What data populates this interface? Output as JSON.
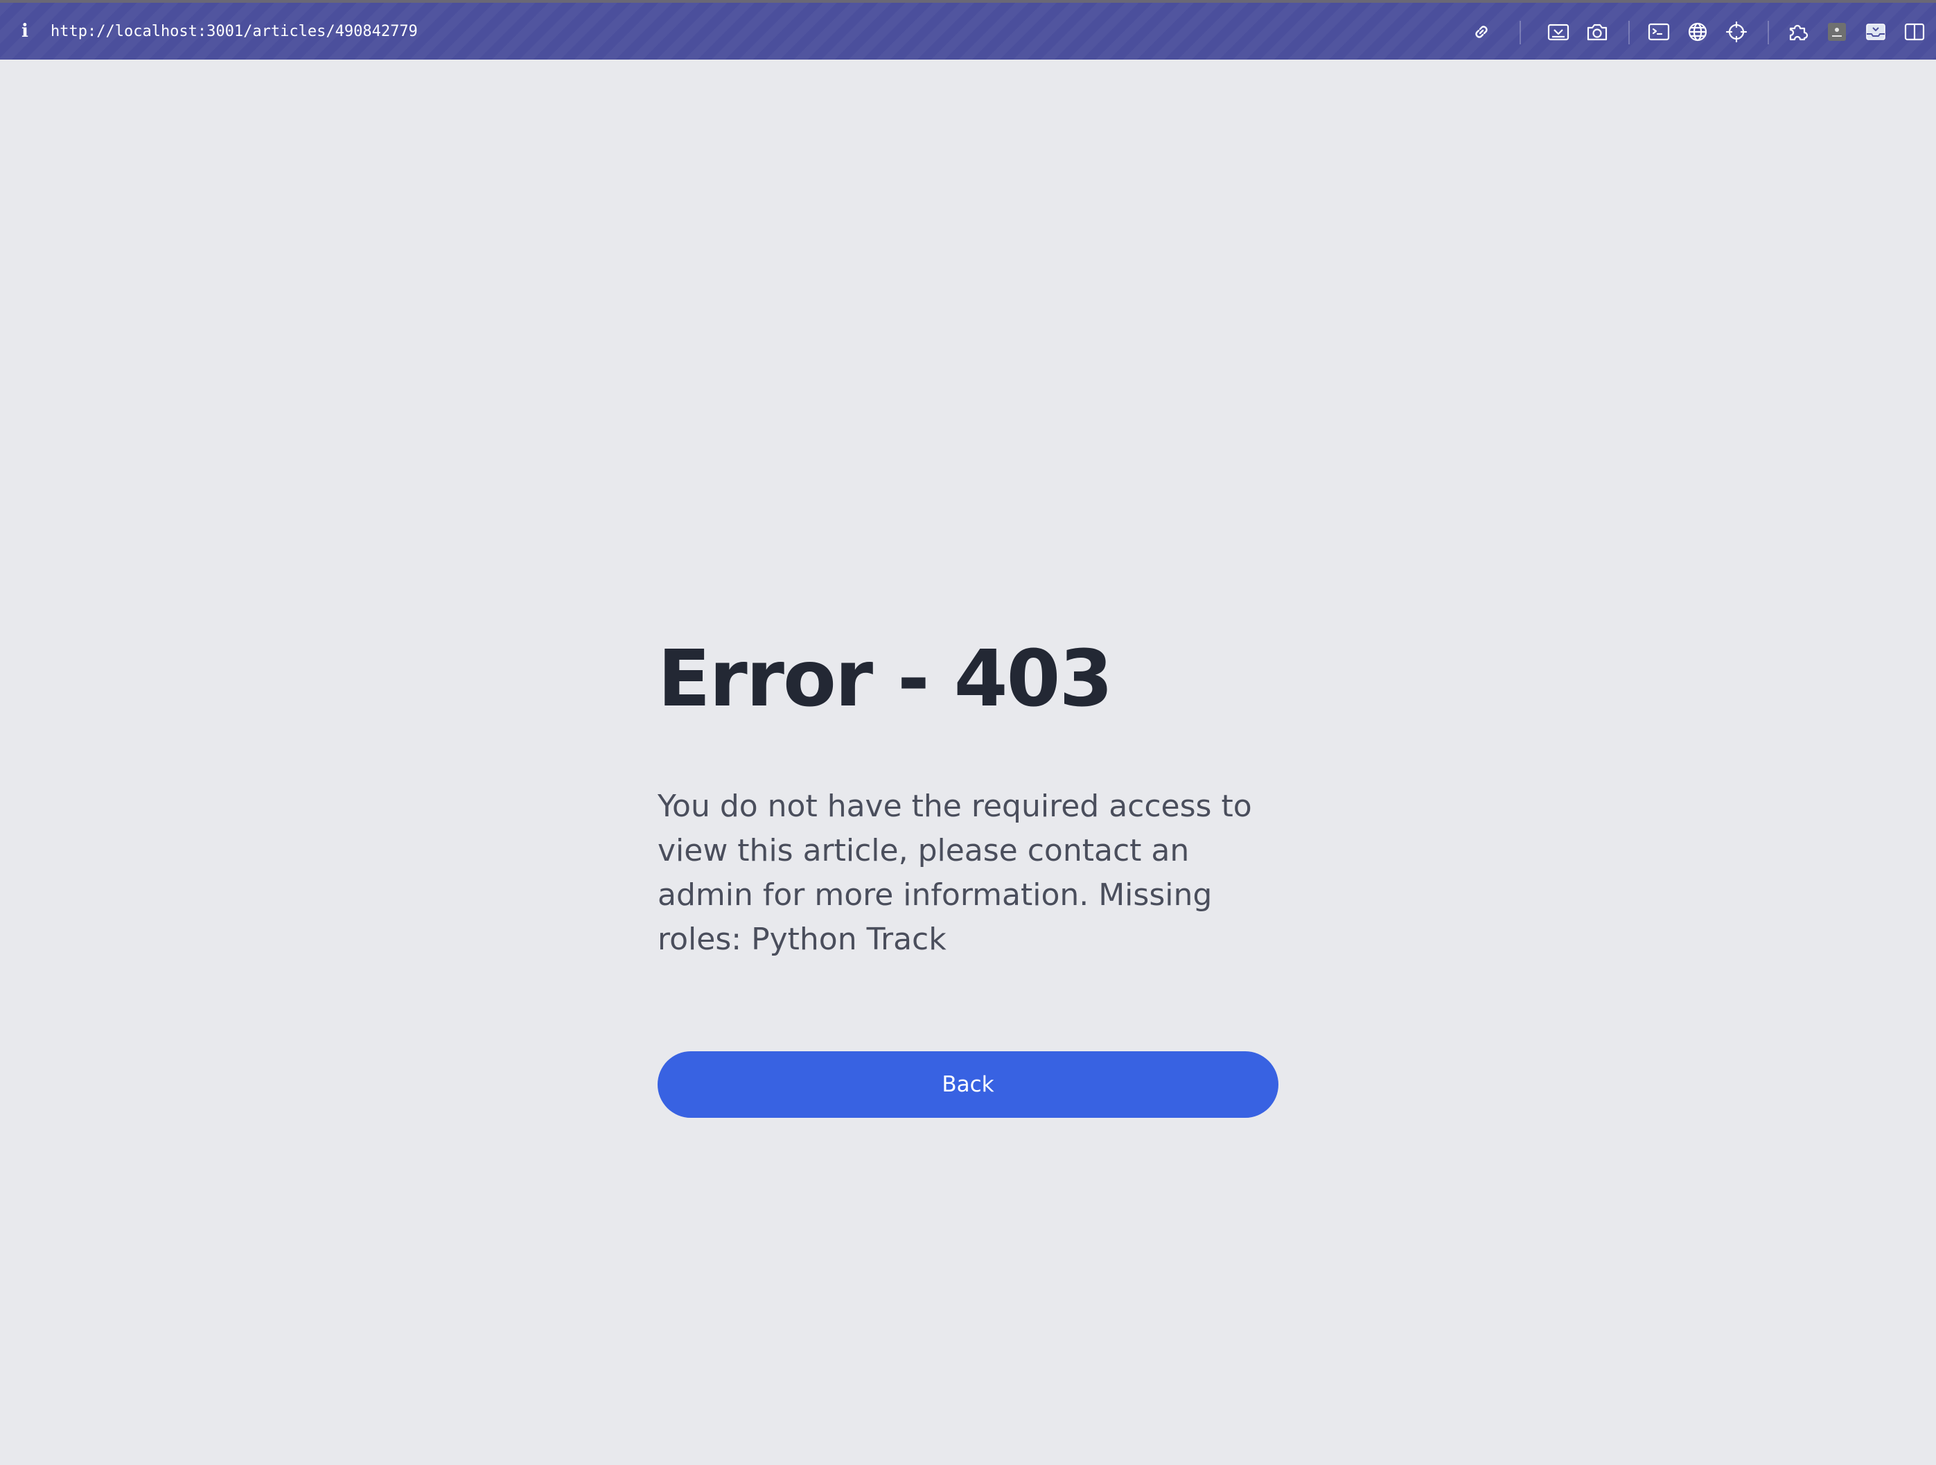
{
  "browser": {
    "url": "http://localhost:3001/articles/490842779",
    "toolbar_icons": [
      "link-icon",
      "save-page-icon",
      "camera-icon",
      "terminal-icon",
      "globe-icon",
      "crosshair-icon",
      "extensions-icon",
      "profile-icon",
      "inbox-icon",
      "split-view-icon"
    ],
    "accent_color": "#4b4f9c"
  },
  "error": {
    "title": "Error - 403",
    "message": "You do not have the required access to view this article, please contact an admin for more information. Missing roles: Python Track",
    "back_label": "Back",
    "button_color": "#3862e2"
  }
}
